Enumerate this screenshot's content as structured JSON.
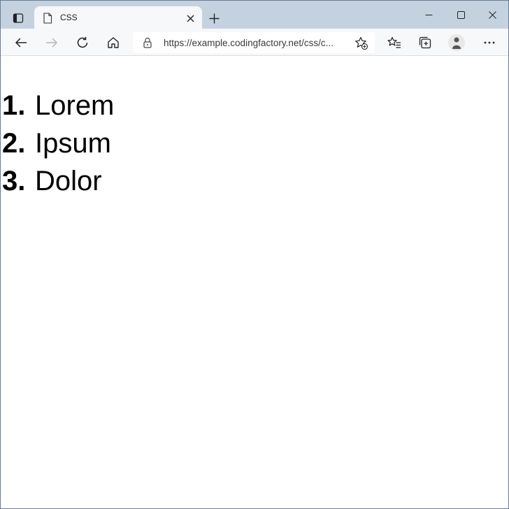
{
  "browser": {
    "tab": {
      "title": "CSS"
    },
    "address_bar": {
      "url": "https://example.codingfactory.net/css/c..."
    },
    "icons": {
      "tab_actions": "tab-actions-icon",
      "page": "page-icon",
      "close_tab": "close-icon",
      "new_tab": "plus-icon",
      "minimize": "minimize-icon",
      "maximize": "maximize-icon",
      "close_window": "close-icon",
      "back": "back-arrow-icon",
      "forward": "forward-arrow-icon",
      "reload": "reload-icon",
      "home": "home-icon",
      "lock": "lock-icon",
      "add_favorite": "star-add-icon",
      "favorites": "favorites-icon",
      "collections": "collections-icon",
      "profile": "profile-icon",
      "more": "more-icon"
    },
    "colors": {
      "tabstrip": "#c4d2e0",
      "toolbar": "#f7f8fa"
    }
  },
  "page": {
    "list": [
      {
        "number": "1.",
        "text": "Lorem"
      },
      {
        "number": "2.",
        "text": "Ipsum"
      },
      {
        "number": "3.",
        "text": "Dolor"
      }
    ]
  }
}
